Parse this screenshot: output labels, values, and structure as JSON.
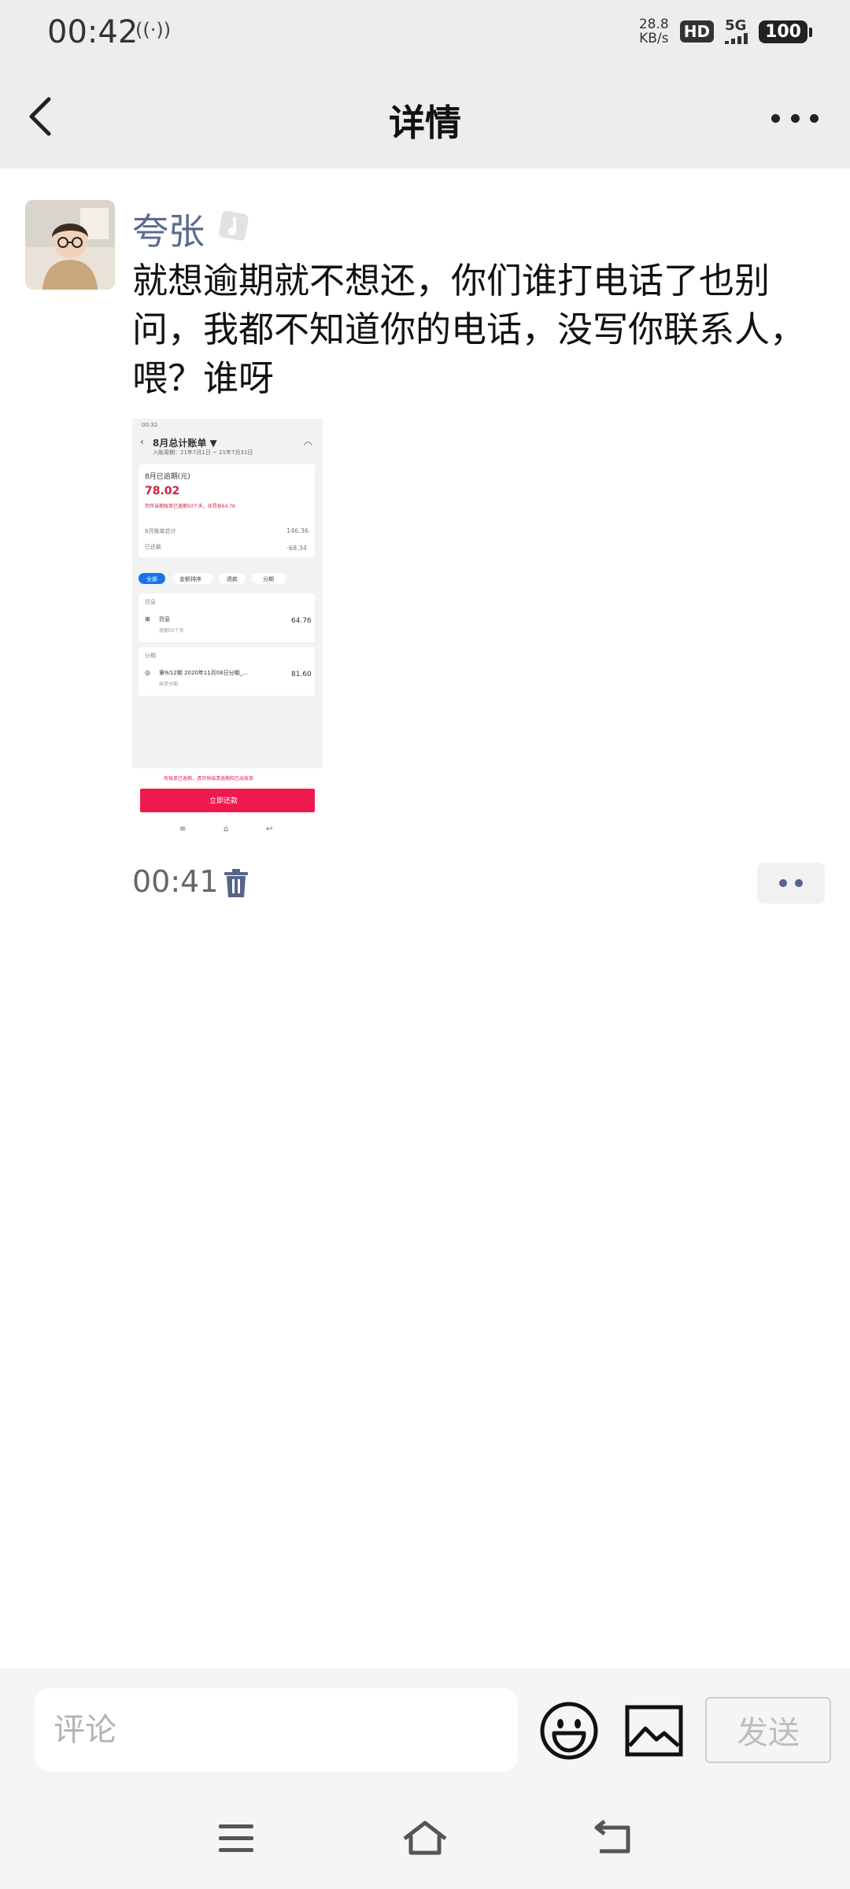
{
  "status_bar": {
    "time": "00:42",
    "net_speed_value": "28.8",
    "net_speed_unit": "KB/s",
    "hd": "HD",
    "signal": "5G",
    "battery": "100"
  },
  "header": {
    "title": "详情"
  },
  "post": {
    "username": "夸张",
    "text": "就想逾期就不想还，你们谁打电话了也别问，我都不知道你的电话，没写你联系人，喂？谁呀",
    "time": "00:41"
  },
  "screenshot": {
    "status_time": "00:32",
    "title": "8月总计账单 ▼",
    "period": "入账周期：21年7月1日 ~ 21年7月31日",
    "overdue_label": "8月已逾期(元)",
    "overdue_amount": "78.02",
    "overdue_note": "您所当期账单已逾期50个天，含罚息64.76",
    "total_label": "8月账单总计",
    "total_value": "146.36",
    "paid_label": "已还款",
    "paid_value": "-68.34",
    "tabs": [
      "全部",
      "金额排序",
      "退款",
      "分期"
    ],
    "penalty_section": "罚息",
    "penalty_item": "罚息",
    "penalty_sub": "逾期50个天",
    "penalty_value": "64.76",
    "install_section": "分期",
    "install_item": "第9/12期 2020年11月08日分期_...",
    "install_sub": "账单分期",
    "install_value": "81.60",
    "footer_note": "有账单已逾期，请尽快结清逾期和已出账单",
    "pay_button": "立即还款"
  },
  "comment": {
    "placeholder": "评论",
    "send_label": "发送"
  },
  "colors": {
    "username": "#5b6a92",
    "accent_red": "#f0194e",
    "tab_blue": "#1a73e8"
  }
}
